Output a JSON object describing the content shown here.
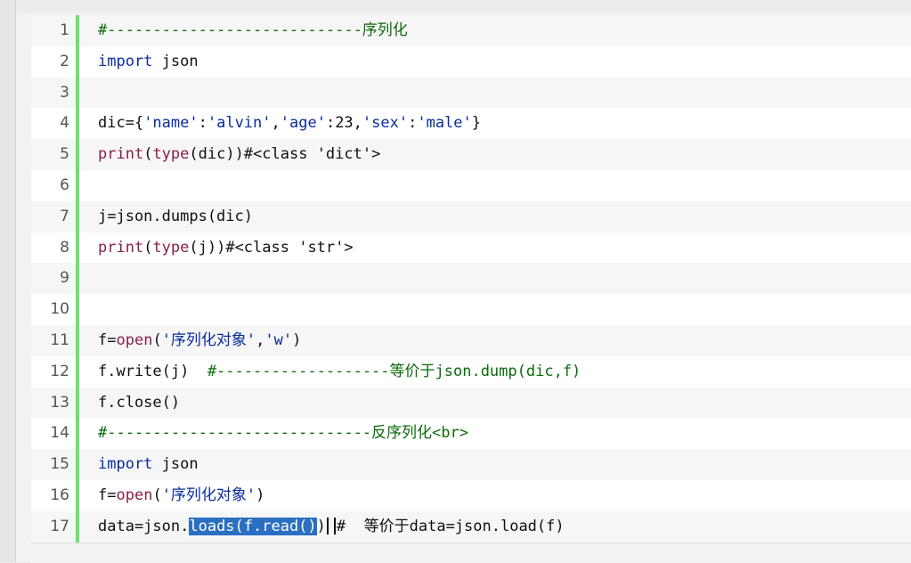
{
  "code_lines": [
    {
      "n": "1",
      "tokens": [
        {
          "t": "#----------------------------序列化",
          "c": "cmt"
        }
      ]
    },
    {
      "n": "2",
      "tokens": [
        {
          "t": "import",
          "c": "kw"
        },
        {
          "t": " json",
          "c": "plain"
        }
      ]
    },
    {
      "n": "3",
      "tokens": []
    },
    {
      "n": "4",
      "tokens": [
        {
          "t": "dic={",
          "c": "plain"
        },
        {
          "t": "'name'",
          "c": "str"
        },
        {
          "t": ":",
          "c": "plain"
        },
        {
          "t": "'alvin'",
          "c": "str"
        },
        {
          "t": ",",
          "c": "plain"
        },
        {
          "t": "'age'",
          "c": "str"
        },
        {
          "t": ":23,",
          "c": "plain"
        },
        {
          "t": "'sex'",
          "c": "str"
        },
        {
          "t": ":",
          "c": "plain"
        },
        {
          "t": "'male'",
          "c": "str"
        },
        {
          "t": "}",
          "c": "plain"
        }
      ]
    },
    {
      "n": "5",
      "tokens": [
        {
          "t": "print",
          "c": "fn"
        },
        {
          "t": "(",
          "c": "plain"
        },
        {
          "t": "type",
          "c": "fn"
        },
        {
          "t": "(dic))#<class 'dict'>",
          "c": "plain"
        }
      ]
    },
    {
      "n": "6",
      "tokens": []
    },
    {
      "n": "7",
      "tokens": [
        {
          "t": "j=json.dumps(dic)",
          "c": "plain"
        }
      ]
    },
    {
      "n": "8",
      "tokens": [
        {
          "t": "print",
          "c": "fn"
        },
        {
          "t": "(",
          "c": "plain"
        },
        {
          "t": "type",
          "c": "fn"
        },
        {
          "t": "(j))#<class 'str'>",
          "c": "plain"
        }
      ]
    },
    {
      "n": "9",
      "tokens": []
    },
    {
      "n": "10",
      "tokens": []
    },
    {
      "n": "11",
      "tokens": [
        {
          "t": "f=",
          "c": "plain"
        },
        {
          "t": "open",
          "c": "fn"
        },
        {
          "t": "(",
          "c": "plain"
        },
        {
          "t": "'序列化对象'",
          "c": "str"
        },
        {
          "t": ",",
          "c": "plain"
        },
        {
          "t": "'w'",
          "c": "str"
        },
        {
          "t": ")",
          "c": "plain"
        }
      ]
    },
    {
      "n": "12",
      "tokens": [
        {
          "t": "f.write(j)  ",
          "c": "plain"
        },
        {
          "t": "#-------------------等价于json.dump(dic,f)",
          "c": "cmt"
        }
      ]
    },
    {
      "n": "13",
      "tokens": [
        {
          "t": "f.close()",
          "c": "plain"
        }
      ]
    },
    {
      "n": "14",
      "tokens": [
        {
          "t": "#-----------------------------反序列化<br>",
          "c": "cmt"
        }
      ]
    },
    {
      "n": "15",
      "tokens": [
        {
          "t": "import",
          "c": "kw"
        },
        {
          "t": " json",
          "c": "plain"
        }
      ]
    },
    {
      "n": "16",
      "tokens": [
        {
          "t": "f=",
          "c": "plain"
        },
        {
          "t": "open",
          "c": "fn"
        },
        {
          "t": "(",
          "c": "plain"
        },
        {
          "t": "'序列化对象'",
          "c": "str"
        },
        {
          "t": ")",
          "c": "plain"
        }
      ]
    },
    {
      "n": "17",
      "tokens": [
        {
          "t": "data=json.",
          "c": "plain"
        },
        {
          "t": "loads(f.read()",
          "c": "sel"
        },
        {
          "t": ")",
          "c": "plain"
        },
        {
          "t": "",
          "c": "cursor"
        },
        {
          "t": "#  ",
          "c": "plain"
        },
        {
          "t": "等价于data=json.load(f)",
          "c": "plain"
        }
      ]
    }
  ]
}
